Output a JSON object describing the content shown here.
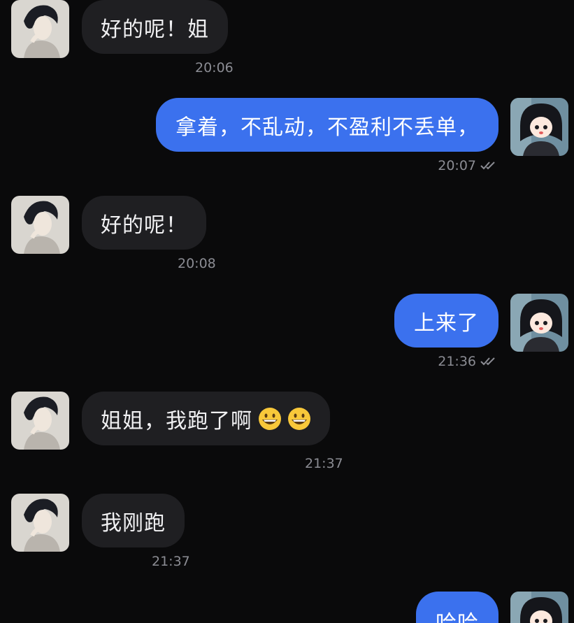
{
  "messages": [
    {
      "side": "in",
      "text": "好的呢！姐",
      "time": "20:06"
    },
    {
      "side": "out",
      "text": "拿着，不乱动，不盈利不丢单，",
      "time": "20:07",
      "status": "read"
    },
    {
      "side": "in",
      "text": "好的呢！",
      "time": "20:08"
    },
    {
      "side": "out",
      "text": "上来了",
      "time": "21:36",
      "status": "read"
    },
    {
      "side": "in",
      "text": "姐姐，我跑了啊",
      "emoji": [
        "grinning-face",
        "grinning-face"
      ],
      "time": "21:37"
    },
    {
      "side": "in",
      "text": "我刚跑",
      "time": "21:37"
    },
    {
      "side": "out",
      "text": "哈哈",
      "time": ""
    }
  ],
  "colors": {
    "background": "#0a0a0b",
    "incoming_bubble": "#1f1f22",
    "outgoing_bubble": "#3b71ee",
    "timestamp": "#8b8c93"
  },
  "icons": {
    "read_status": "double-check-icon",
    "emoji": "grinning-face-emoji"
  }
}
